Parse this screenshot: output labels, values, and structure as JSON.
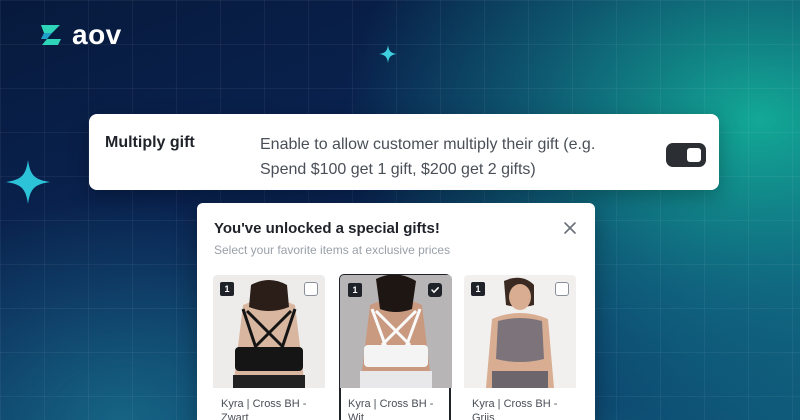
{
  "brand": {
    "name": "aov",
    "accent": "#2fd5b8"
  },
  "setting": {
    "title": "Multiply gift",
    "description": "Enable to allow customer multiply their gift (e.g. Spend $100 get 1 gift, $200 get 2 gifts)",
    "enabled": true
  },
  "modal": {
    "title": "You've unlocked a special gifts!",
    "subtitle": "Select your favorite items at exclusive prices",
    "close_icon": "close-icon",
    "products": [
      {
        "qty": "1",
        "name": "Kyra | Cross BH - Zwart",
        "selected": false,
        "color": "black"
      },
      {
        "qty": "1",
        "name": "Kyra | Cross BH - Wit",
        "selected": true,
        "color": "white"
      },
      {
        "qty": "1",
        "name": "Kyra | Cross BH - Grijs",
        "selected": false,
        "color": "grey"
      }
    ]
  }
}
